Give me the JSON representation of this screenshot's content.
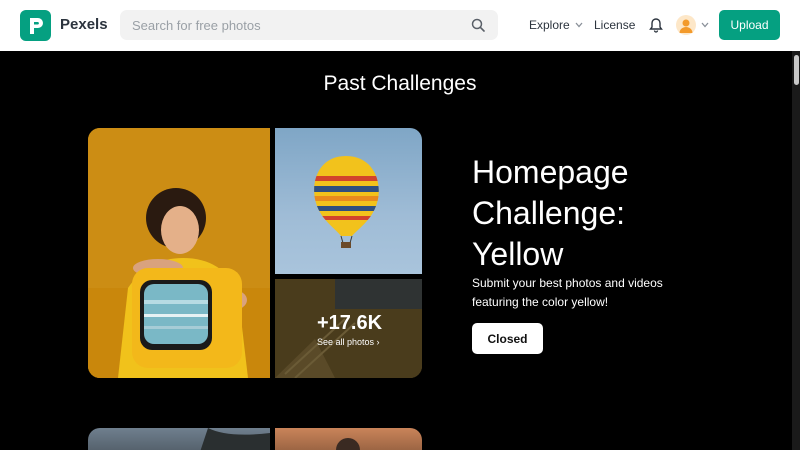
{
  "header": {
    "logo_letter": "P",
    "brand": "Pexels",
    "search_placeholder": "Search for free photos",
    "nav": {
      "explore": "Explore",
      "license": "License"
    },
    "upload_label": "Upload",
    "colors": {
      "brand": "#05a081"
    }
  },
  "main": {
    "section_title": "Past Challenges",
    "challenge": {
      "title": "Homepage Challenge: Yellow",
      "description": "Submit your best photos and videos featuring the color yellow!",
      "status_button": "Closed",
      "photo_count": "+17.6K",
      "see_all": "See all photos ›"
    }
  }
}
